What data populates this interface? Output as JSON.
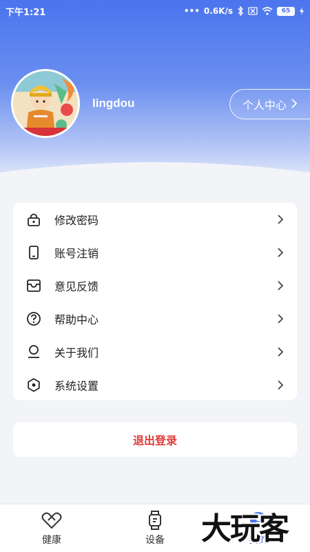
{
  "status_bar": {
    "time": "下午1:21",
    "network_speed": "0.6K/s",
    "battery": "65"
  },
  "profile": {
    "username": "lingdou",
    "center_button": "个人中心"
  },
  "menu": {
    "items": [
      {
        "label": "修改密码",
        "icon": "lock-icon"
      },
      {
        "label": "账号注销",
        "icon": "phone-icon"
      },
      {
        "label": "意见反馈",
        "icon": "inbox-icon"
      },
      {
        "label": "帮助中心",
        "icon": "help-icon"
      },
      {
        "label": "关于我们",
        "icon": "user-icon"
      },
      {
        "label": "系统设置",
        "icon": "settings-icon"
      }
    ]
  },
  "logout_label": "退出登录",
  "tabs": [
    {
      "label": "健康",
      "icon": "health-icon",
      "active": false
    },
    {
      "label": "设备",
      "icon": "watch-icon",
      "active": false
    },
    {
      "label": "我的",
      "icon": "profile-icon",
      "active": true
    }
  ],
  "watermark": "大玩客",
  "colors": {
    "accent": "#4b74ee",
    "logout": "#e23b3b"
  }
}
